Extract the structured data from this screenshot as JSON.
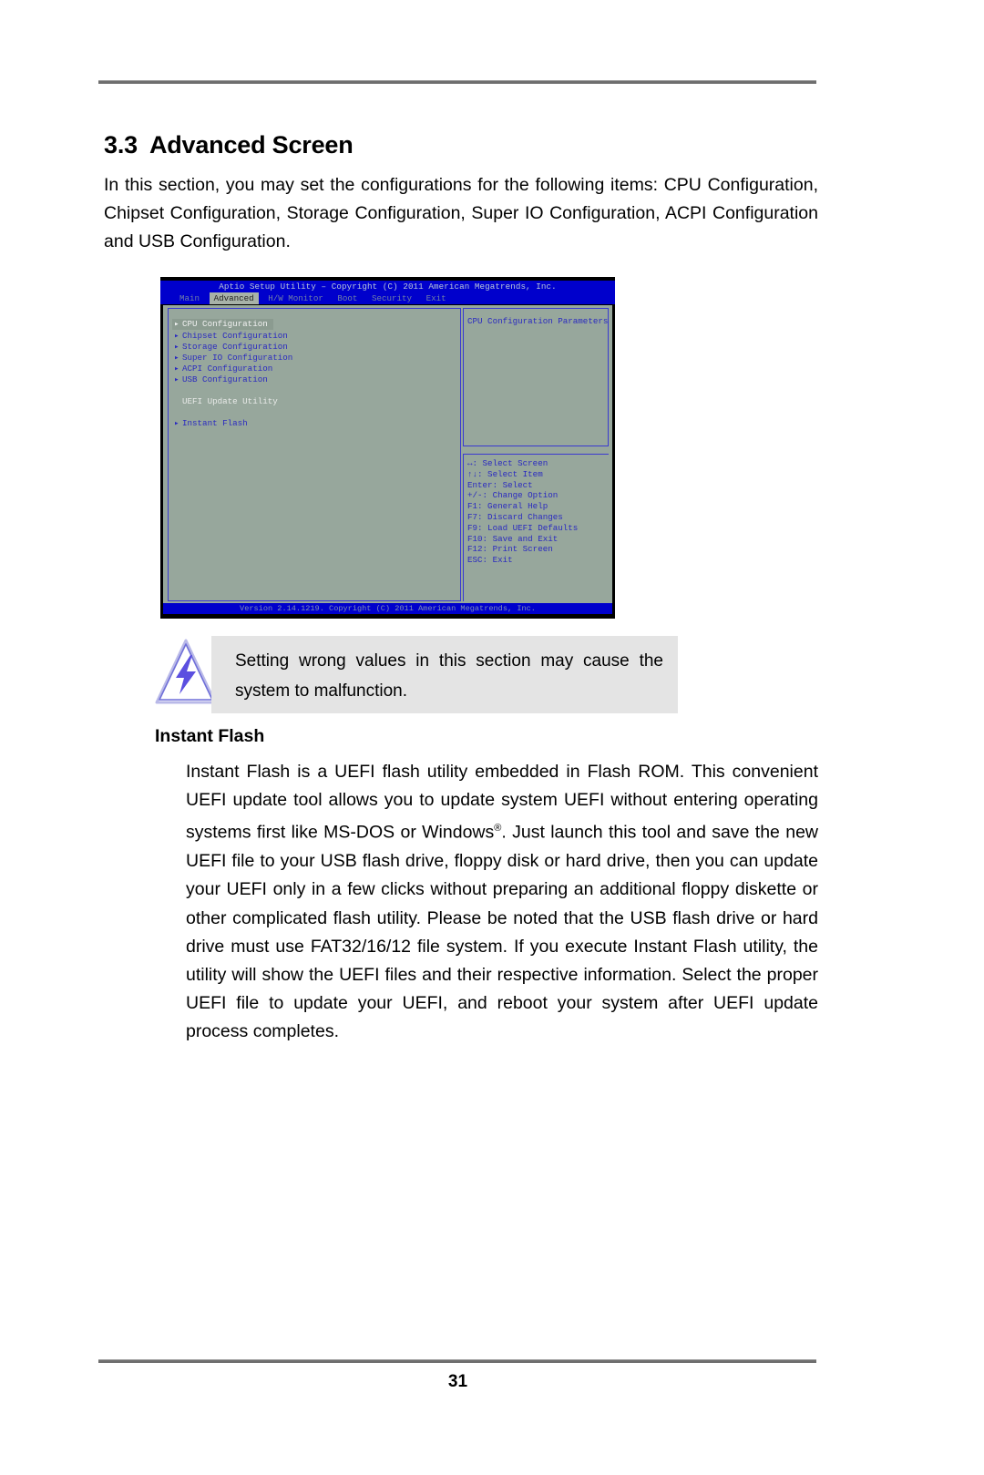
{
  "document": {
    "page_number": "31"
  },
  "section": {
    "number": "3.3",
    "title": "Advanced Screen",
    "intro": "In this section, you may set the configurations for the following items: CPU Configuration, Chipset Configuration, Storage Configuration, Super IO Configuration, ACPI Configuration and USB Configuration."
  },
  "bios": {
    "title": "Aptio Setup Utility – Copyright (C) 2011 American Megatrends, Inc.",
    "tabs": [
      {
        "label": "Main",
        "active": false
      },
      {
        "label": "Advanced",
        "active": true
      },
      {
        "label": "H/W Monitor",
        "active": false
      },
      {
        "label": "Boot",
        "active": false
      },
      {
        "label": "Security",
        "active": false
      },
      {
        "label": "Exit",
        "active": false
      }
    ],
    "menu": [
      {
        "label": "CPU Configuration",
        "selected": true
      },
      {
        "label": "Chipset Configuration",
        "selected": false
      },
      {
        "label": "Storage Configuration",
        "selected": false
      },
      {
        "label": "Super IO Configuration",
        "selected": false
      },
      {
        "label": "ACPI Configuration",
        "selected": false
      },
      {
        "label": "USB Configuration",
        "selected": false
      }
    ],
    "group_heading": "UEFI Update Utility",
    "group_items": [
      {
        "label": "Instant Flash",
        "selected": false
      }
    ],
    "help_text": "CPU Configuration Parameters",
    "keys": [
      "↔: Select Screen",
      "↑↓: Select Item",
      "Enter: Select",
      "+/-: Change Option",
      "F1: General Help",
      "F7: Discard Changes",
      "F9: Load UEFI Defaults",
      "F10: Save and Exit",
      "F12: Print Screen",
      "ESC: Exit"
    ],
    "version": "Version 2.14.1219. Copyright (C) 2011 American Megatrends, Inc."
  },
  "note": {
    "text": "Setting wrong values in this section may cause the system to malfunction."
  },
  "instant_flash": {
    "heading": "Instant Flash",
    "paragraph_before_sup": "Instant Flash is a UEFI flash utility embedded in Flash ROM. This convenient UEFI update tool allows you to update system UEFI without entering operating systems first like MS-DOS or Windows",
    "registered_mark": "®",
    "paragraph_after_sup": ". Just launch this tool and save the new UEFI file to your USB flash drive, floppy disk or hard drive, then you can update your UEFI only in a few clicks without preparing an additional floppy diskette or other complicated flash utility. Please be noted that the USB flash drive or hard drive must use FAT32/16/12 file system. If you execute Instant Flash utility, the utility will show the UEFI files and their respective information. Select the proper UEFI file to update your UEFI, and reboot your system after UEFI update process completes."
  },
  "colors": {
    "bios_bg": "#97a79c",
    "bios_blue": "#0000cc",
    "bios_text": "#2a2ac0",
    "note_bg": "#e4e4e4"
  }
}
